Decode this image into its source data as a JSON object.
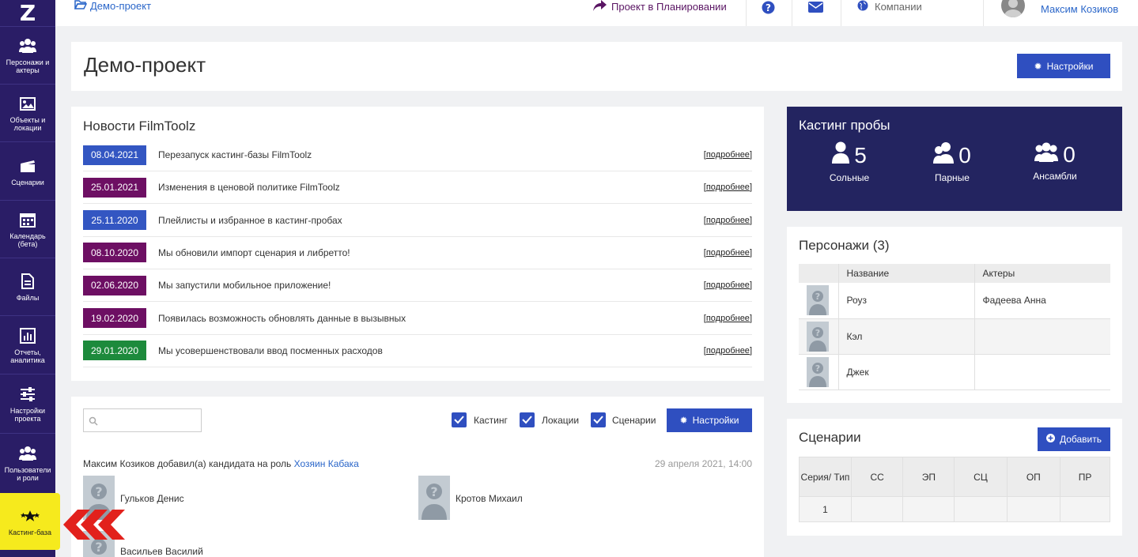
{
  "sidebar": {
    "logo": "Z",
    "items": [
      {
        "label": "Персонажи и актеры",
        "icon": "users-icon"
      },
      {
        "label": "Объекты и локации",
        "icon": "image-icon"
      },
      {
        "label": "Сценарии",
        "icon": "clapperboard-icon"
      },
      {
        "label": "Календарь (бета)",
        "icon": "calendar-icon"
      },
      {
        "label": "Файлы",
        "icon": "file-icon"
      },
      {
        "label": "Отчеты, аналитика",
        "icon": "bar-chart-icon"
      },
      {
        "label": "Настройки проекта",
        "icon": "sliders-icon"
      },
      {
        "label": "Пользователи и роли",
        "icon": "users-icon"
      },
      {
        "label": "Кастинг-база",
        "icon": "stars-icon",
        "active": true
      }
    ]
  },
  "topbar": {
    "breadcrumb": "Демо-проект",
    "project_status": "Проект в Планировании",
    "companies": "Компании",
    "user_name": "Максим Козиков"
  },
  "header": {
    "title": "Демо-проект",
    "settings_label": "Настройки"
  },
  "news": {
    "title": "Новости FilmToolz",
    "more_label": "подробнее",
    "items": [
      {
        "date": "08.04.2021",
        "text": "Перезапуск кастинг-базы FilmToolz",
        "color": "#3356c2"
      },
      {
        "date": "25.01.2021",
        "text": "Изменения в ценовой политике FilmToolz",
        "color": "#6d0f63"
      },
      {
        "date": "25.11.2020",
        "text": "Плейлисты и избранное в кастинг-пробах",
        "color": "#3356c2"
      },
      {
        "date": "08.10.2020",
        "text": "Мы обновили импорт сценария и либретто!",
        "color": "#6d0f63"
      },
      {
        "date": "02.06.2020",
        "text": "Мы запустили мобильное приложение!",
        "color": "#6d0f63"
      },
      {
        "date": "19.02.2020",
        "text": "Появилась возможность обновлять данные в вызывных",
        "color": "#6d0f63"
      },
      {
        "date": "29.01.2020",
        "text": "Мы усовершенствовали ввод посменных расходов",
        "color": "#1d8a3c"
      }
    ]
  },
  "feed": {
    "search_placeholder": "",
    "filters": [
      "Кастинг",
      "Локации",
      "Сценарии"
    ],
    "settings_label": "Настройки",
    "event_text": "Максим Козиков добавил(а) кандидата на роль",
    "event_role": "Хозяин Кабака",
    "event_time": "29 апреля 2021, 14:00",
    "candidates": [
      "Гульков Денис",
      "Кротов Михаил",
      "Васильев Василий"
    ]
  },
  "casting": {
    "title": "Кастинг пробы",
    "stats": [
      {
        "value": "5",
        "label": "Сольные"
      },
      {
        "value": "0",
        "label": "Парные"
      },
      {
        "value": "0",
        "label": "Ансамбли"
      }
    ]
  },
  "characters": {
    "title": "Персонажи (3)",
    "columns": [
      "Название",
      "Актеры"
    ],
    "rows": [
      {
        "name": "Роуз",
        "actor": "Фадеева Анна"
      },
      {
        "name": "Кэл",
        "actor": ""
      },
      {
        "name": "Джек",
        "actor": ""
      }
    ]
  },
  "scenarios": {
    "title": "Сценарии",
    "add_label": "Добавить",
    "columns": [
      "Серия/ Тип",
      "СС",
      "ЭП",
      "СЦ",
      "ОП",
      "ПР"
    ],
    "rows": [
      [
        "1",
        "",
        "",
        "",
        "",
        ""
      ]
    ]
  }
}
